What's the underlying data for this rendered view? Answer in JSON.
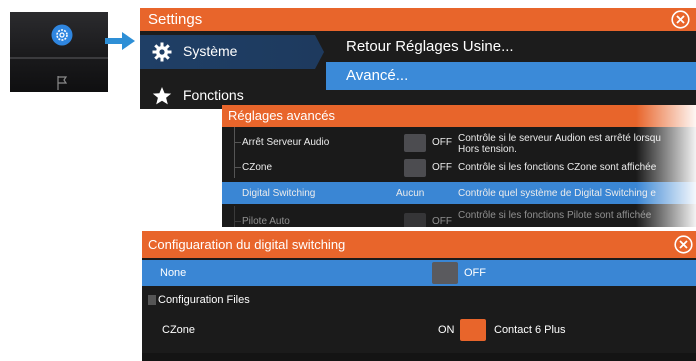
{
  "settings": {
    "title": "Settings",
    "left_items": [
      {
        "label": "Système",
        "icon": "gear-icon",
        "selected": true
      },
      {
        "label": "Fonctions",
        "icon": "star-icon",
        "selected": false
      }
    ],
    "right_items": [
      {
        "label": "Retour Réglages Usine...",
        "selected": false
      },
      {
        "label": "Avancé...",
        "selected": true
      }
    ]
  },
  "advanced": {
    "title": "Réglages avancés",
    "rows": [
      {
        "name": "Arrêt Serveur Audio",
        "state": "OFF",
        "description": "Contrôle si le serveur Audion est arrêté lorsqu Hors tension."
      },
      {
        "name": "CZone",
        "state": "OFF",
        "description": "Contrôle si les fonctions CZone sont affichée"
      },
      {
        "name": "Digital Switching",
        "value": "Aucun",
        "description": "Contrôle quel système de Digital Switching e"
      },
      {
        "name": "Pilote Auto",
        "state": "OFF",
        "description": "Contrôle si les fonctions Pilote sont affichée"
      }
    ]
  },
  "config": {
    "title": "Configuaration du digital switching",
    "rows": {
      "none": {
        "name": "None",
        "state": "OFF"
      },
      "files": {
        "name": "Configuration Files"
      },
      "czone": {
        "name": "CZone",
        "state": "ON",
        "value": "Contact 6 Plus"
      }
    }
  },
  "colors": {
    "accent_orange": "#e8652b",
    "selection_blue": "#3a86d4",
    "panel_dark": "#1c1c1c"
  }
}
